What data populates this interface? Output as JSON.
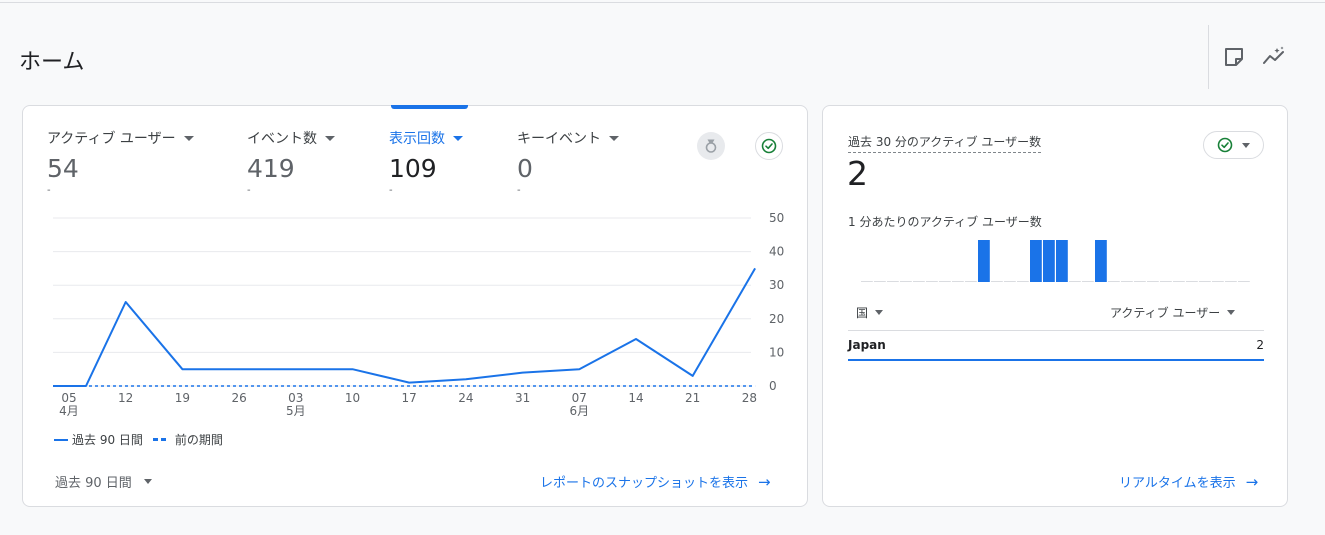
{
  "page": {
    "title": "ホーム",
    "colors": {
      "accent": "#1a73e8",
      "success": "#188038",
      "grid": "#e8eaed"
    }
  },
  "header_icons": [
    {
      "name": "note-icon"
    },
    {
      "name": "insights-icon"
    }
  ],
  "metrics": [
    {
      "label": "アクティブ ユーザー",
      "value": "54",
      "sub": "-",
      "active": false
    },
    {
      "label": "イベント数",
      "value": "419",
      "sub": "-",
      "active": false
    },
    {
      "label": "表示回数",
      "value": "109",
      "sub": "-",
      "active": true
    },
    {
      "label": "キーイベント",
      "value": "0",
      "sub": "-",
      "active": false
    }
  ],
  "legend": {
    "current": "過去 90 日間",
    "previous": "前の期間"
  },
  "period_select": "過去 90 日間",
  "snapshot_link": "レポートのスナップショットを表示",
  "chart_data": {
    "type": "line",
    "x_tick_labels": [
      "05",
      "12",
      "19",
      "26",
      "03",
      "10",
      "17",
      "24",
      "31",
      "07",
      "14",
      "21",
      "28"
    ],
    "x_month_labels": [
      "4月",
      "",
      "",
      "",
      "5月",
      "",
      "",
      "",
      "",
      "6月",
      "",
      "",
      ""
    ],
    "ylim": [
      0,
      50
    ],
    "yticks": [
      "0",
      "10",
      "20",
      "30",
      "40",
      "50"
    ],
    "grid": true,
    "legend_position": "bottom-left",
    "series": [
      {
        "name": "過去 90 日間",
        "style": "solid",
        "points": [
          {
            "x": 0,
            "y": 0
          },
          {
            "x": 0.3,
            "y": 0
          },
          {
            "x": 1,
            "y": 25
          },
          {
            "x": 2,
            "y": 5
          },
          {
            "x": 3,
            "y": 5
          },
          {
            "x": 4,
            "y": 5
          },
          {
            "x": 5,
            "y": 5
          },
          {
            "x": 6,
            "y": 1
          },
          {
            "x": 7,
            "y": 2
          },
          {
            "x": 8,
            "y": 4
          },
          {
            "x": 9,
            "y": 5
          },
          {
            "x": 10,
            "y": 14
          },
          {
            "x": 11,
            "y": 3
          },
          {
            "x": 12.1,
            "y": 35
          }
        ]
      },
      {
        "name": "前の期間",
        "style": "dashed",
        "points": [
          {
            "x": 0,
            "y": 0
          },
          {
            "x": 12.1,
            "y": 0
          }
        ]
      }
    ]
  },
  "realtime": {
    "title": "過去 30 分のアクティブ ユーザー数",
    "value": "2",
    "subtitle": "1 分あたりのアクティブ ユーザー数",
    "per_minute": [
      0,
      0,
      0,
      0,
      0,
      0,
      0,
      0,
      0,
      1,
      0,
      0,
      0,
      1,
      1,
      1,
      0,
      0,
      1,
      0,
      0,
      0,
      0,
      0,
      0,
      0,
      0,
      0,
      0,
      0
    ],
    "col_country": "国",
    "col_users": "アクティブ ユーザー",
    "rows": [
      {
        "country": "Japan",
        "users": "2"
      }
    ],
    "link": "リアルタイムを表示"
  }
}
